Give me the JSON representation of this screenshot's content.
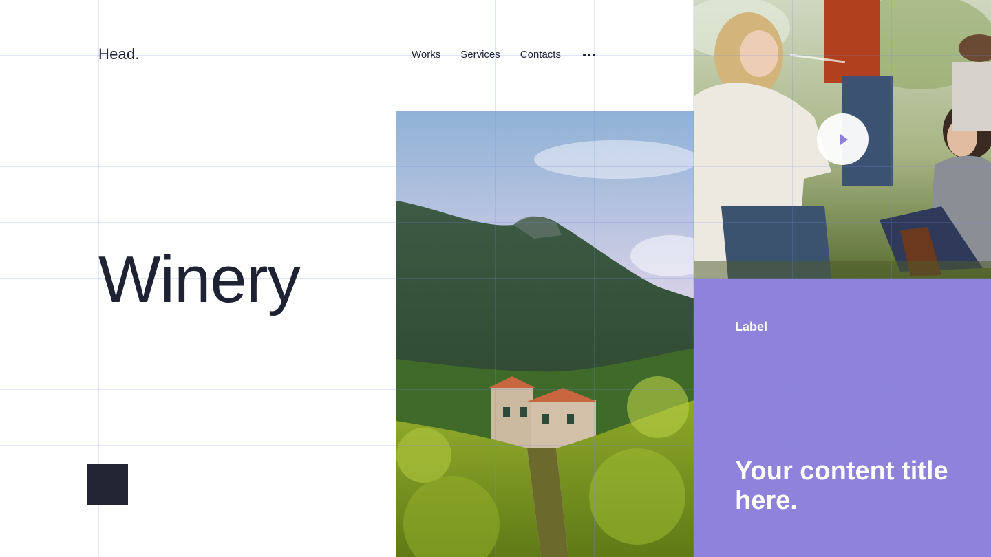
{
  "header": {
    "logo": "Head.",
    "nav": [
      {
        "label": "Works"
      },
      {
        "label": "Services"
      },
      {
        "label": "Contacts"
      }
    ],
    "more_icon": "more-horizontal-icon"
  },
  "hero": {
    "title": "Winery"
  },
  "media": {
    "play_icon": "play-icon"
  },
  "card": {
    "label": "Label",
    "title": "Your content title here."
  },
  "colors": {
    "text": "#1e2233",
    "accent": "#8f82da",
    "dark_square": "#212534",
    "grid_line": "#d9ddf7"
  }
}
